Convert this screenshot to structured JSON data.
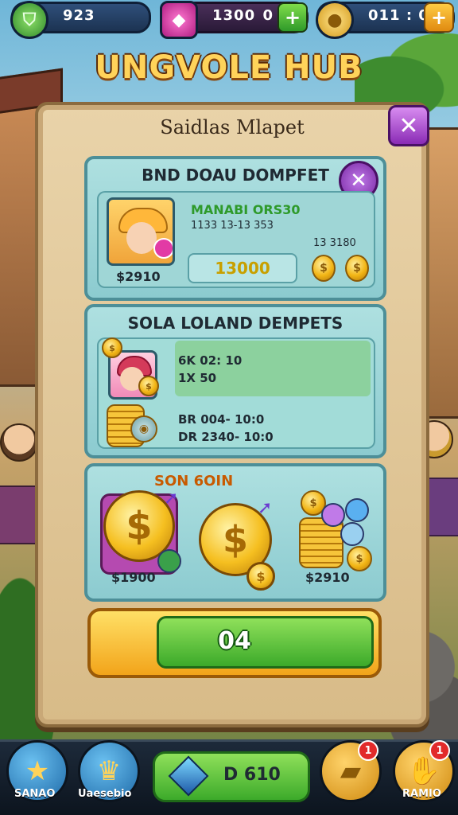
{
  "hud": {
    "stat1_value": "923",
    "stat2_value": "1300",
    "stat2_value2": "0",
    "stat3_value": "011 : 0",
    "plus": "+"
  },
  "hub_title": "UNGVOLE HUB",
  "panel": {
    "title": "Saidlas Mlapet",
    "close": "✕",
    "card1": {
      "heading": "BND DOAU DOMPFET",
      "close": "✕",
      "name": "MANABI ORS30",
      "subtitle": "1133 13-13 353",
      "price": "$2910",
      "field_value": "13000",
      "mini_label": "13 3180"
    },
    "card2": {
      "heading": "SOLA LOLAND DEMPETS",
      "line1": "6K 02: 10",
      "line2": "1X 50",
      "line3": "BR 004- 10:0",
      "line4": "DR 2340- 10:0"
    },
    "card3": {
      "heading": "SON 6OIN",
      "price_left": "$1900",
      "price_right": "$2910"
    },
    "progress": {
      "value": "04",
      "fill_fraction": 0.78
    }
  },
  "bottom_nav": {
    "left1_label": "SANAO",
    "left2_label": "Uaesebio",
    "shop_label": "D 610",
    "right2_label": "RAMIO",
    "badge_count": "1"
  },
  "colors": {
    "accent_gold": "#ffd35a",
    "button_green": "#3caa2a",
    "close_purple": "#8a2bb5",
    "card_teal": "#8ccbd0"
  }
}
